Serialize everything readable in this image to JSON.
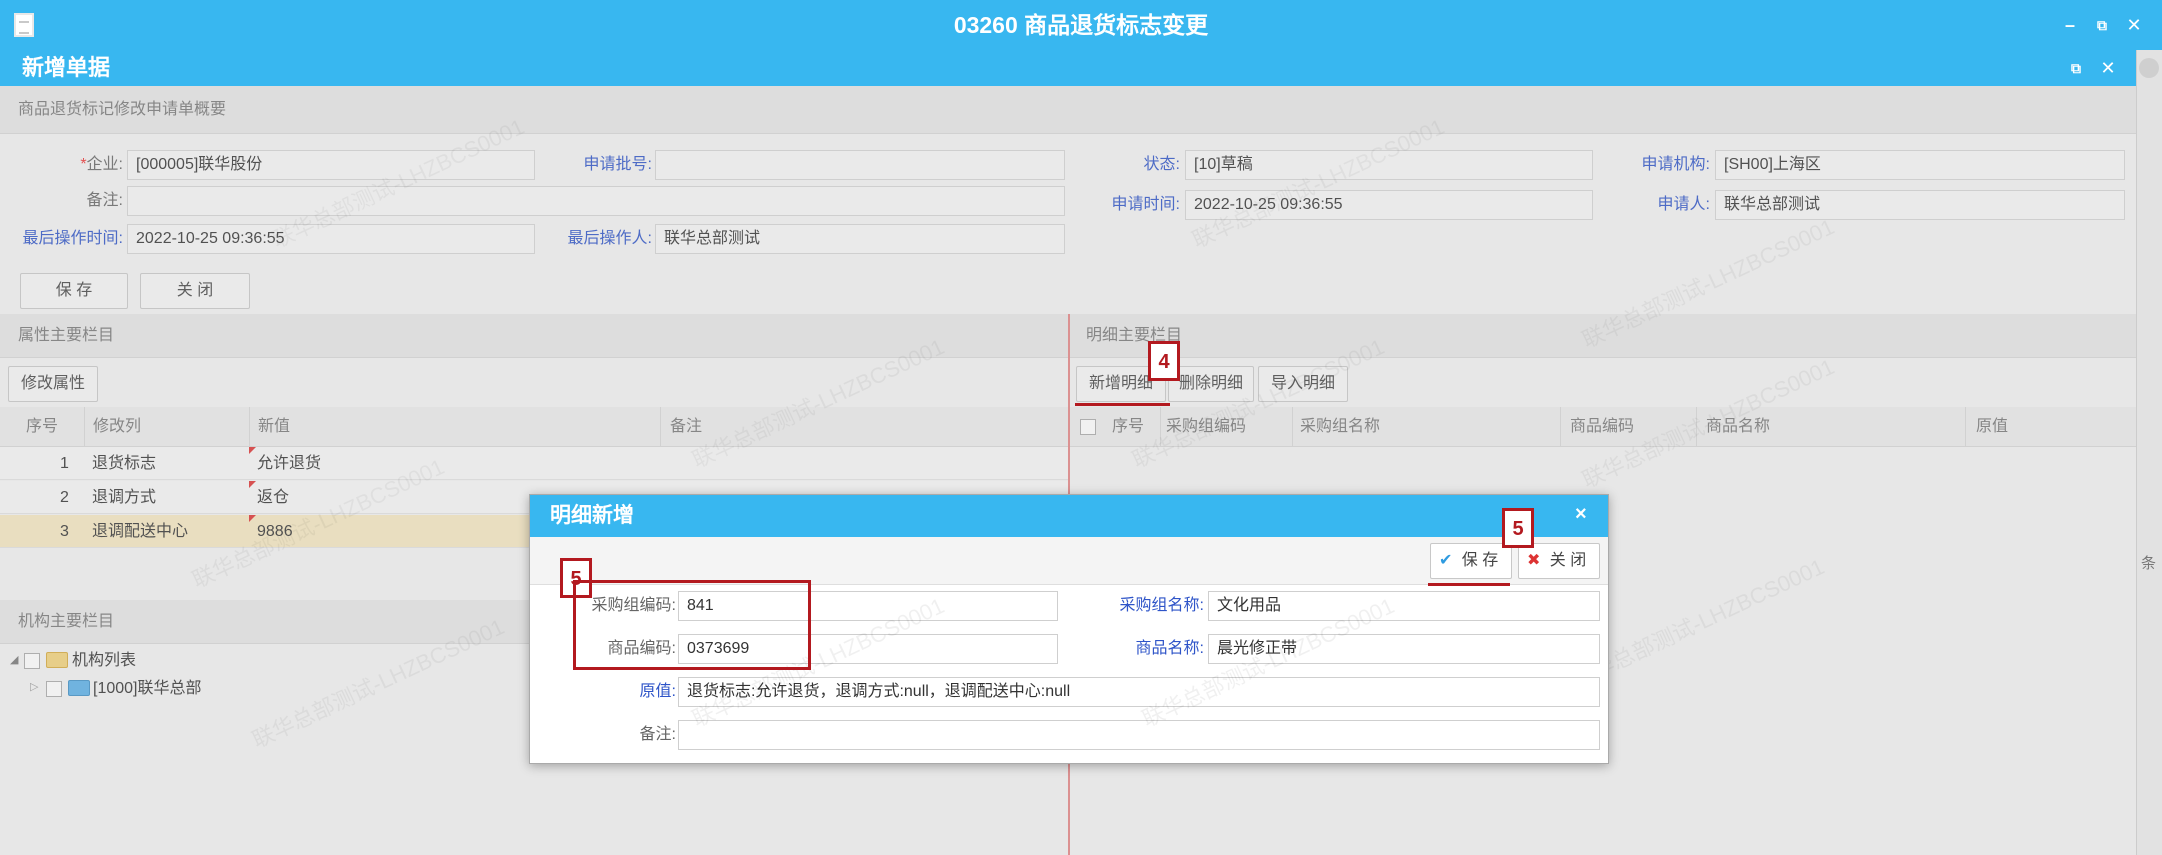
{
  "window": {
    "title": "03260 商品退货标志变更",
    "min": "–",
    "restore": "⧉",
    "close": "✕"
  },
  "subwindow": {
    "title": "新增单据",
    "restore": "⧉",
    "close": "✕"
  },
  "summary": {
    "section_title": "商品退货标记修改申请单概要",
    "fields": {
      "company_label": "企业:",
      "company_req": "*",
      "company_value": "[000005]联华股份",
      "batch_label": "申请批号:",
      "batch_value": "",
      "status_label": "状态:",
      "status_value": "[10]草稿",
      "org_label": "申请机构:",
      "org_value": "[SH00]上海区",
      "remark_label": "备注:",
      "remark_value": "",
      "apply_time_label": "申请时间:",
      "apply_time_value": "2022-10-25 09:36:55",
      "applicant_label": "申请人:",
      "applicant_value": "联华总部测试",
      "last_time_label": "最后操作时间:",
      "last_time_value": "2022-10-25 09:36:55",
      "last_user_label": "最后操作人:",
      "last_user_value": "联华总部测试"
    },
    "save_button": "保 存",
    "close_button": "关 闭"
  },
  "attr_panel": {
    "section_title": "属性主要栏目",
    "modify_button": "修改属性",
    "columns": [
      "序号",
      "修改列",
      "新值",
      "备注"
    ],
    "rows": [
      {
        "no": "1",
        "col": "退货标志",
        "val": "允许退货",
        "remark": ""
      },
      {
        "no": "2",
        "col": "退调方式",
        "val": "返仓",
        "remark": ""
      },
      {
        "no": "3",
        "col": "退调配送中心",
        "val": "9886",
        "remark": ""
      }
    ]
  },
  "org_panel": {
    "section_title": "机构主要栏目",
    "tree": [
      {
        "label": "机构列表",
        "expander": "◢"
      },
      {
        "label": "[1000]联华总部",
        "expander": "▷"
      }
    ]
  },
  "detail_panel": {
    "section_title": "明细主要栏目",
    "buttons": {
      "add": "新增明细",
      "delete": "删除明细",
      "import": "导入明细"
    },
    "columns": [
      "序号",
      "采购组编码",
      "采购组名称",
      "商品编码",
      "商品名称",
      "原值"
    ]
  },
  "dialog": {
    "title": "明细新增",
    "close": "×",
    "save_button": "保 存",
    "close_button": "关 闭",
    "fields": {
      "pg_code_label": "采购组编码:",
      "pg_code_value": "841",
      "pg_name_label": "采购组名称:",
      "pg_name_value": "文化用品",
      "item_code_label": "商品编码:",
      "item_code_value": "0373699",
      "item_name_label": "商品名称:",
      "item_name_value": "晨光修正带",
      "orig_label": "原值:",
      "orig_value": "退货标志:允许退货，退调方式:null，退调配送中心:null",
      "remark_label": "备注:",
      "remark_value": ""
    }
  },
  "annotations": {
    "step4": "4",
    "step5a": "5",
    "step5b": "5"
  },
  "right_strip_text": "条",
  "watermark": "联华总部测试-LHZBCS0001",
  "colors": {
    "titlebar": "#38b7f0",
    "annotation": "#b3191f",
    "label_blue": "#2e54c8"
  }
}
